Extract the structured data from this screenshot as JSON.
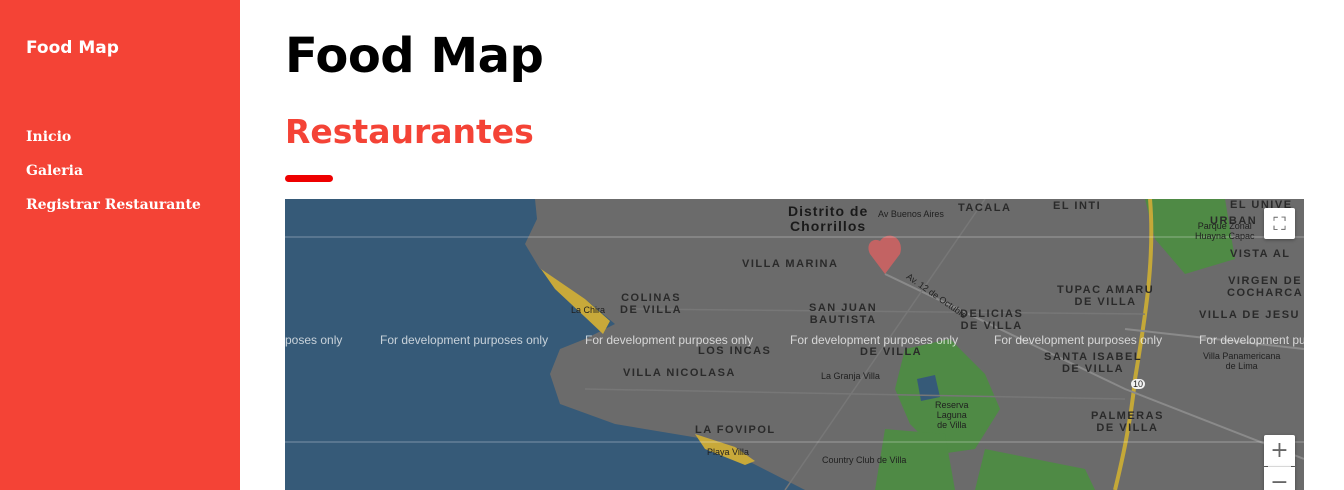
{
  "sidebar": {
    "brand": "Food Map",
    "nav": [
      {
        "label": "Inicio"
      },
      {
        "label": "Galeria"
      },
      {
        "label": "Registrar Restaurante"
      }
    ]
  },
  "main": {
    "title": "Food Map",
    "subtitle": "Restaurantes"
  },
  "map": {
    "watermark": "For development purposes only",
    "watermark_cut_left": "poses only",
    "watermark_cut_right": "For development pu",
    "labels": {
      "distrito": "Distrito de",
      "chorrillos": "Chorrillos",
      "av_buenos_aires": "Av Buenos Aires",
      "tacala": "TACALA",
      "el_inti": "EL INTI",
      "el_unive": "EL UNIVE",
      "urban": "URBAN",
      "parque_zonal_1": "Parque Zonal",
      "parque_zonal_2": "Huayna Capac",
      "villa_marina": "VILLA MARINA",
      "vista_al": "VISTA AL",
      "colinas_1": "COLINAS",
      "colinas_2": "DE VILLA",
      "la_chira": "La Chira",
      "san_juan_1": "SAN JUAN",
      "san_juan_2": "BAUTISTA",
      "delicias_1": "DELICIAS",
      "delicias_2": "DE VILLA",
      "tupac_1": "TUPAC AMARU",
      "tupac_2": "DE VILLA",
      "virgen_1": "VIRGEN DE",
      "virgen_2": "COCHARCA",
      "villa_jesus": "VILLA DE JESU",
      "los_incas": "LOS INCAS",
      "de_villa_mid": "DE VILLA",
      "santa_isabel_1": "SANTA ISABEL",
      "santa_isabel_2": "DE VILLA",
      "villa_panamericana_1": "Villa Panamericana",
      "villa_panamericana_2": "de Lima",
      "villa_nicolasa": "VILLA NICOLASA",
      "la_granja": "La Granja Villa",
      "reserva_1": "Reserva",
      "reserva_2": "Laguna",
      "reserva_3": "de Villa",
      "palmeras_1": "PALMERAS",
      "palmeras_2": "DE VILLA",
      "la_fovipol": "LA FOVIPOL",
      "playa_villa": "Playa Villa",
      "country_club": "Country Club de Villa",
      "av_12_octubre": "Av. 12 de Octubre",
      "route_10": "10"
    },
    "controls": {
      "fullscreen": "⛶",
      "zoom_in": "+",
      "zoom_out": "−"
    },
    "colors": {
      "sea": "#365a78",
      "land": "#6b6b6b",
      "park": "#4f8a45",
      "beach": "#c8a93a",
      "highway": "#c4a838",
      "marker": "#e06060"
    }
  }
}
